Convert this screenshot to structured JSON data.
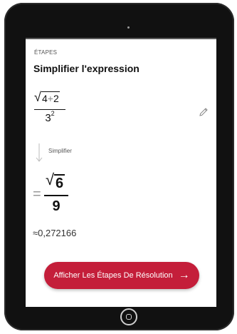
{
  "section": {
    "label": "ÉTAPES",
    "title": "Simplifier l'expression"
  },
  "expression": {
    "radicand_a": "4",
    "operator": "+",
    "radicand_b": "2",
    "denominator_base": "3",
    "denominator_exp": "2"
  },
  "step": {
    "label": "Simplifier"
  },
  "result": {
    "equals": "=",
    "numerator": "6",
    "denominator": "9"
  },
  "approximation": "≈0,272166",
  "cta": {
    "label": "Afficher Les Étapes De Résolution",
    "arrow": "→"
  },
  "icons": {
    "edit": "pencil-icon",
    "step_arrow": "arrow-down-icon",
    "cta_arrow": "arrow-right-icon",
    "home": "home-button-icon"
  },
  "colors": {
    "accent": "#c41e3a",
    "device": "#111111"
  }
}
